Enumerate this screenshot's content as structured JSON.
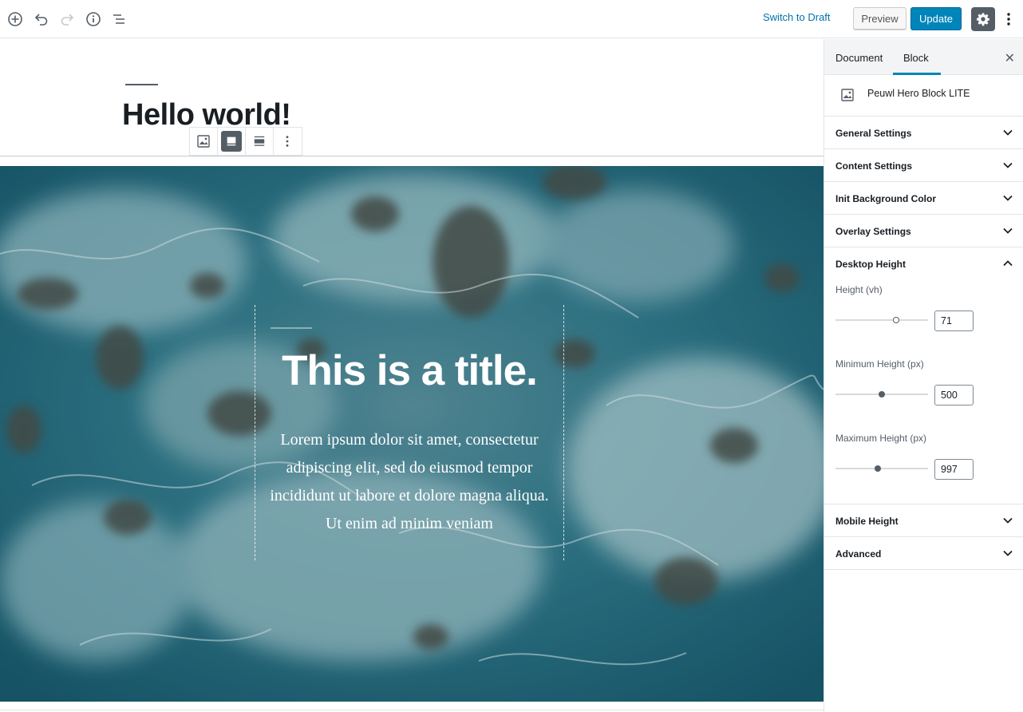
{
  "topbar": {
    "icons": [
      "add-block-icon",
      "undo-icon",
      "redo-icon",
      "info-icon",
      "outline-icon"
    ],
    "switch_to_draft": "Switch to Draft",
    "preview": "Preview",
    "update": "Update"
  },
  "editor": {
    "post_title": "Hello world!",
    "hero_title": "This is a title.",
    "hero_text": "Lorem ipsum dolor sit amet, consectetur adipiscing elit, sed do eiusmod tempor incididunt ut labore et dolore magna aliqua. Ut enim ad minim veniam"
  },
  "sidebar": {
    "tab_document": "Document",
    "tab_block": "Block",
    "close": "✕",
    "block_name": "Peuwl Hero Block LITE",
    "panels": [
      {
        "title": "General Settings"
      },
      {
        "title": "Content Settings"
      },
      {
        "title": "Init Background Color"
      },
      {
        "title": "Overlay Settings"
      }
    ],
    "desktop_height": {
      "title": "Desktop Height",
      "height_label": "Height (vh)",
      "height_value": "71",
      "min_label": "Minimum Height (px)",
      "min_value": "500",
      "max_label": "Maximum Height (px)",
      "max_value": "997"
    },
    "bottom_panels": [
      {
        "title": "Mobile Height"
      },
      {
        "title": "Advanced"
      }
    ]
  }
}
